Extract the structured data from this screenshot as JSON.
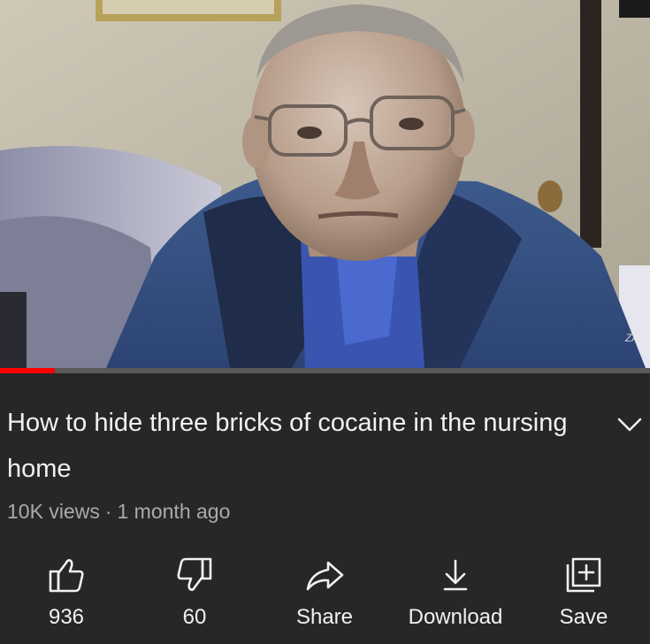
{
  "video": {
    "watermark": "ZAR",
    "progress_fraction": 0.085
  },
  "title": "How to hide three bricks of cocaine in the nursing home",
  "meta": {
    "views": "10K views",
    "separator": "·",
    "age": "1 month ago"
  },
  "actions": {
    "like": {
      "label": "936",
      "icon": "thumbs-up-icon"
    },
    "dislike": {
      "label": "60",
      "icon": "thumbs-down-icon"
    },
    "share": {
      "label": "Share",
      "icon": "share-arrow-icon"
    },
    "download": {
      "label": "Download",
      "icon": "download-arrow-icon"
    },
    "save": {
      "label": "Save",
      "icon": "playlist-add-icon"
    }
  },
  "colors": {
    "background": "#272727",
    "progress": "#ff0000",
    "text": "#f1f1f1",
    "meta_text": "#aaaaaa"
  }
}
